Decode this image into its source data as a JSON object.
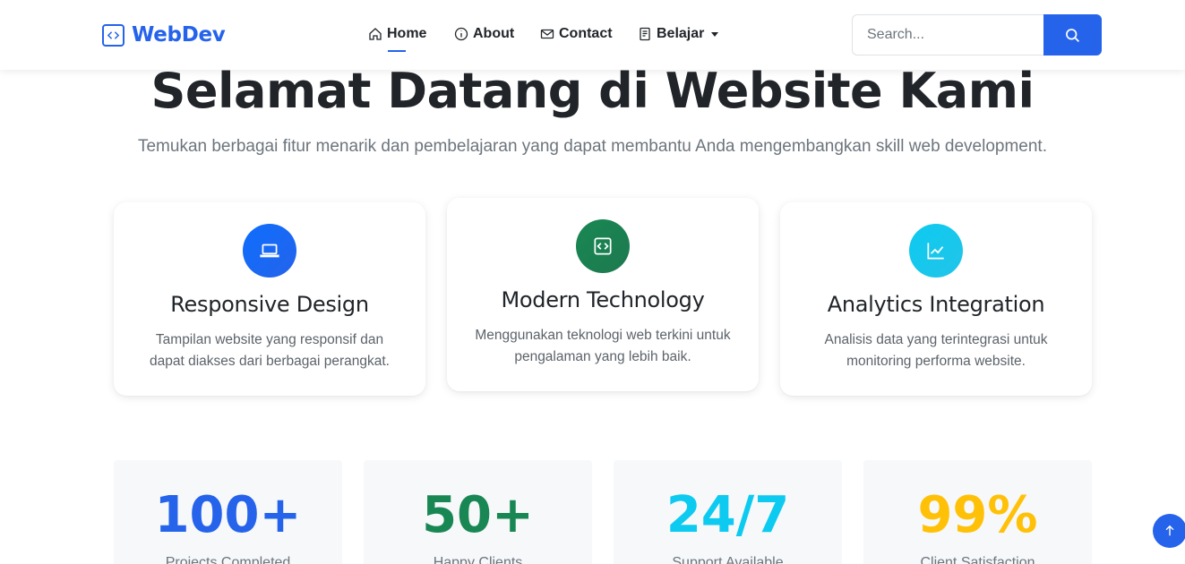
{
  "navbar": {
    "brand": "WebDev",
    "items": [
      {
        "label": "Home",
        "icon": "house-icon",
        "active": true
      },
      {
        "label": "About",
        "icon": "info-circle-icon"
      },
      {
        "label": "Contact",
        "icon": "envelope-icon"
      },
      {
        "label": "Belajar",
        "icon": "journal-text-icon",
        "dropdown": true
      }
    ],
    "search": {
      "placeholder": "Search...",
      "value": ""
    }
  },
  "hero": {
    "title": "Selamat Datang di Website Kami",
    "subtitle": "Temukan berbagai fitur menarik dan pembelajaran yang dapat membantu Anda mengembangkan skill web development."
  },
  "features": [
    {
      "title": "Responsive Design",
      "description": "Tampilan website yang responsif dan dapat diakses dari berbagai perangkat.",
      "icon": "laptop-icon",
      "color": "#2563eb"
    },
    {
      "title": "Modern Technology",
      "description": "Menggunakan teknologi web terkini untuk pengalaman yang lebih baik.",
      "icon": "code-square-icon",
      "color": "#198754"
    },
    {
      "title": "Analytics Integration",
      "description": "Analisis data yang terintegrasi untuk monitoring performa website.",
      "icon": "graph-up-icon",
      "color": "#0dcaf0"
    }
  ],
  "stats": [
    {
      "value": "100+",
      "label": "Projects Completed",
      "color": "#2563eb"
    },
    {
      "value": "50+",
      "label": "Happy Clients",
      "color": "#198754"
    },
    {
      "value": "24/7",
      "label": "Support Available",
      "color": "#0dcaf0"
    },
    {
      "value": "99%",
      "label": "Client Satisfaction",
      "color": "#ffc107"
    }
  ]
}
